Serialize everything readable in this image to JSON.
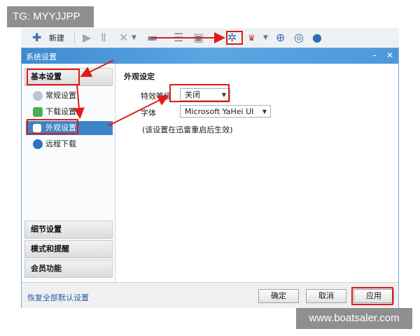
{
  "watermark_top": "TG: MYYJJPP",
  "watermark_bottom": "www.boatsaler.com",
  "toolbar": {
    "new_label": "新建"
  },
  "dialog": {
    "title": "系统设置",
    "sidebar": {
      "basic_settings": "基本设置",
      "items": [
        {
          "label": "常规设置"
        },
        {
          "label": "下载设置"
        },
        {
          "label": "外观设置"
        },
        {
          "label": "远程下载"
        }
      ],
      "detail_settings": "细节设置",
      "mode_reminders": "模式和提醒",
      "member_features": "会员功能"
    },
    "content": {
      "section_title": "外观设定",
      "effect_label": "特效等级",
      "effect_value": "关闭",
      "font_label": "字体",
      "font_value": "Microsoft YaHei UI",
      "note": "(该设置在迅雷重启后生效)"
    },
    "footer": {
      "restore_defaults": "恢复全部默认设置",
      "ok": "确定",
      "cancel": "取消",
      "apply": "应用"
    }
  },
  "colors": {
    "annotation_red": "#e01a1a",
    "title_blue": "#3c8ad1",
    "active_blue": "#3d84c6"
  }
}
